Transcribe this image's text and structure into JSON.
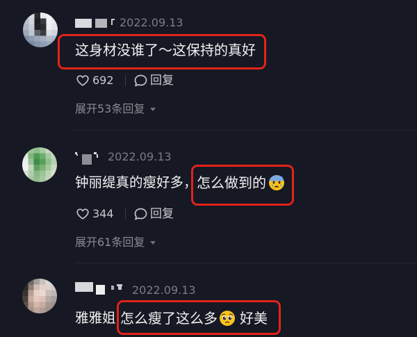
{
  "theme": {
    "background": "#161823",
    "text_color": "#f1f1f3",
    "muted_color": "#7b7c84",
    "highlight_border_color": "#e2231a"
  },
  "comments": [
    {
      "date": "2022.09.13",
      "text_highlighted": "这身材没谁了～这保持的真好",
      "likes": "692",
      "like_icon": "heart-outline-icon",
      "reply_label": "回复",
      "reply_icon": "speech-bubble-icon",
      "expand_label": "展开53条回复",
      "expand_icon": "chevron-down-icon"
    },
    {
      "date": "2022.09.13",
      "text_before": "钟丽缇真的瘦好多，",
      "text_highlighted": "怎么做到的",
      "emoji": "anxious-face-with-sweat",
      "likes": "344",
      "like_icon": "heart-outline-icon",
      "reply_label": "回复",
      "reply_icon": "speech-bubble-icon",
      "expand_label": "展开61条回复",
      "expand_icon": "chevron-down-icon"
    },
    {
      "date": "2022.09.13",
      "text_before": "雅雅姐",
      "text_highlighted": "怎么瘦了这么多",
      "emoji": "pleading-face",
      "text_after": "好美"
    }
  ]
}
